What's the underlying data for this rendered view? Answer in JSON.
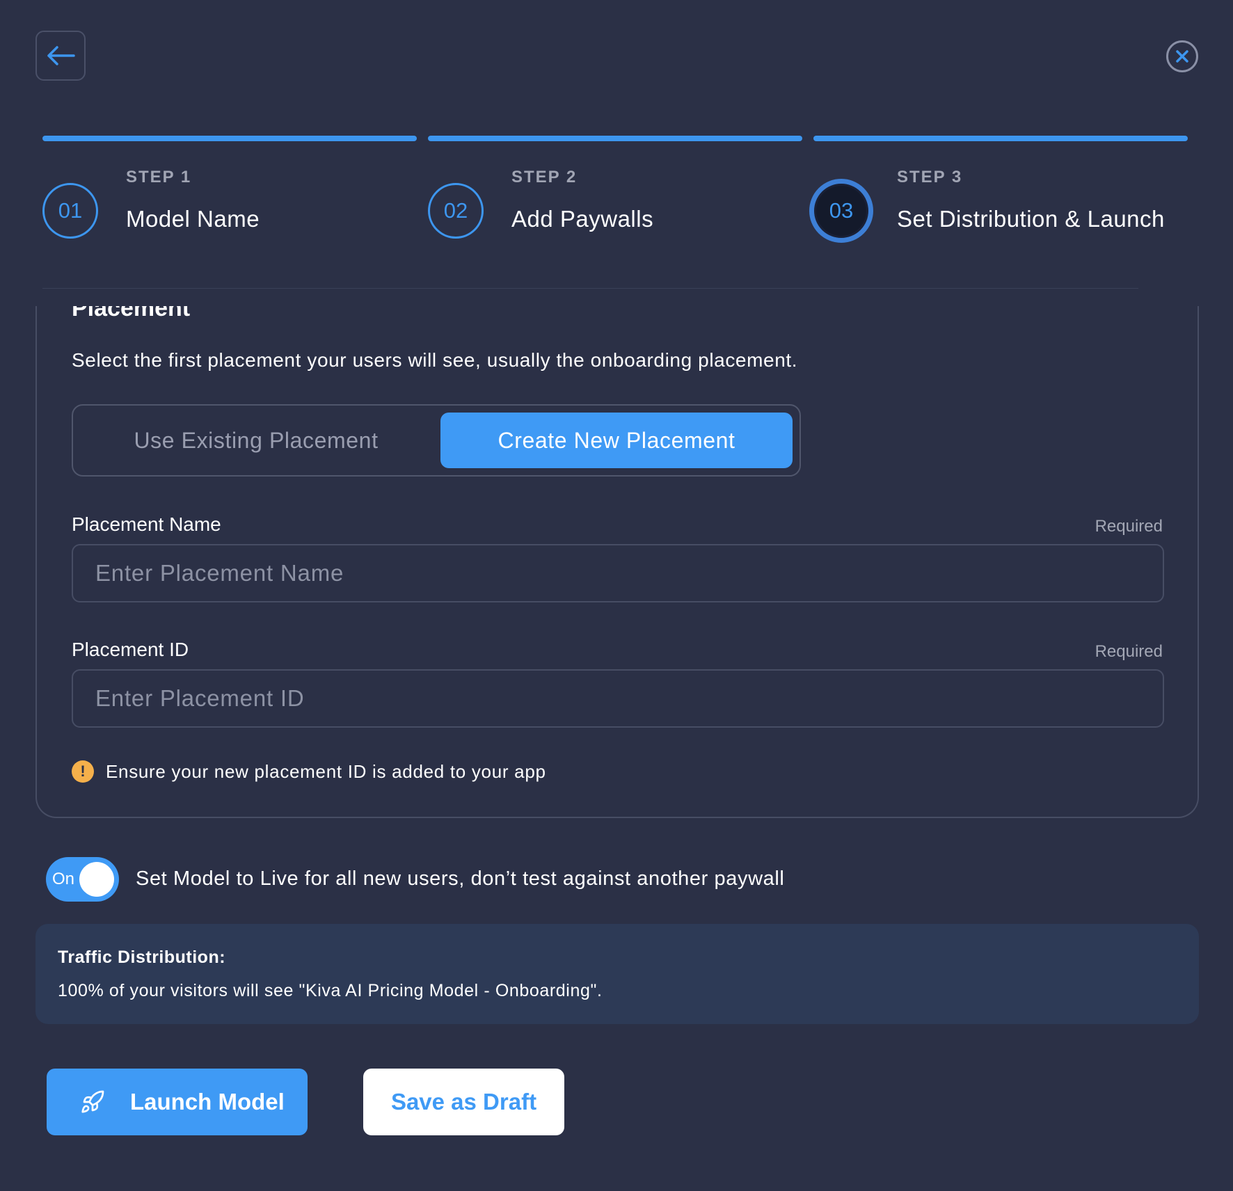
{
  "header": {
    "back_icon": "arrow-left-icon",
    "close_icon": "close-icon"
  },
  "steps": [
    {
      "number": "01",
      "kicker": "STEP 1",
      "title": "Model Name"
    },
    {
      "number": "02",
      "kicker": "STEP 2",
      "title": "Add Paywalls"
    },
    {
      "number": "03",
      "kicker": "STEP 3",
      "title": "Set Distribution & Launch"
    }
  ],
  "placement": {
    "title": "Placement",
    "description": "Select the first placement your users will see, usually the onboarding placement.",
    "options": [
      "Use Existing Placement",
      "Create New Placement"
    ],
    "selected_option": "Create New Placement",
    "name_label": "Placement Name",
    "name_required": "Required",
    "name_placeholder": "Enter Placement Name",
    "id_label": "Placement ID",
    "id_required": "Required",
    "id_placeholder": "Enter Placement ID",
    "warning_icon": "!",
    "warning_text": "Ensure your new placement ID is added to your app"
  },
  "live_toggle": {
    "state_label": "On",
    "text": "Set Model to Live for all new users, don’t test against another paywall"
  },
  "traffic": {
    "heading": "Traffic Distribution:",
    "text": "100% of your visitors will see \"Kiva AI Pricing Model - Onboarding\"."
  },
  "actions": {
    "launch_label": "Launch Model",
    "launch_icon": "rocket-icon",
    "draft_label": "Save as Draft"
  },
  "colors": {
    "background": "#2b3046",
    "accent": "#3f9af5",
    "warning": "#f5b04b"
  }
}
